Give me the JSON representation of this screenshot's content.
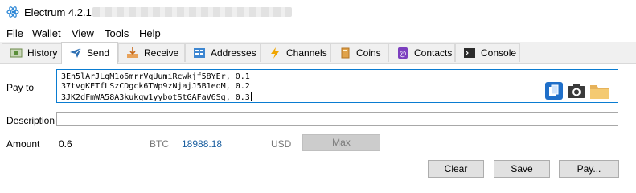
{
  "window": {
    "title": "Electrum 4.2.1  -"
  },
  "menu": [
    "File",
    "Wallet",
    "View",
    "Tools",
    "Help"
  ],
  "tabs": [
    {
      "label": "History",
      "icon": "history-icon"
    },
    {
      "label": "Send",
      "icon": "send-icon"
    },
    {
      "label": "Receive",
      "icon": "receive-icon"
    },
    {
      "label": "Addresses",
      "icon": "addresses-icon"
    },
    {
      "label": "Channels",
      "icon": "lightning-icon"
    },
    {
      "label": "Coins",
      "icon": "coins-icon"
    },
    {
      "label": "Contacts",
      "icon": "contacts-icon"
    },
    {
      "label": "Console",
      "icon": "console-icon"
    }
  ],
  "active_tab": "Send",
  "form": {
    "pay_to_label": "Pay to",
    "pay_to_lines": [
      "3En5lArJLqM1o6mrrVqUumiRcwkjf58YEr, 0.1",
      "37tvgKETfLSzCDgck6TWp9zNjajJ5B1eoM, 0.2",
      "3JK2dFmWA58A3kukgw1yybotStGAFaV6Sg, 0.3"
    ],
    "description_label": "Description",
    "description_value": "",
    "amount_label": "Amount",
    "amount_value": "0.6",
    "amount_unit": "BTC",
    "fiat_value": "18988.18",
    "fiat_unit": "USD",
    "max_label": "Max"
  },
  "buttons": {
    "clear": "Clear",
    "save": "Save",
    "pay": "Pay..."
  },
  "colors": {
    "accent": "#0a7cd1",
    "fiat_text": "#1b5fa0",
    "disabled_button": "#cccccc"
  }
}
